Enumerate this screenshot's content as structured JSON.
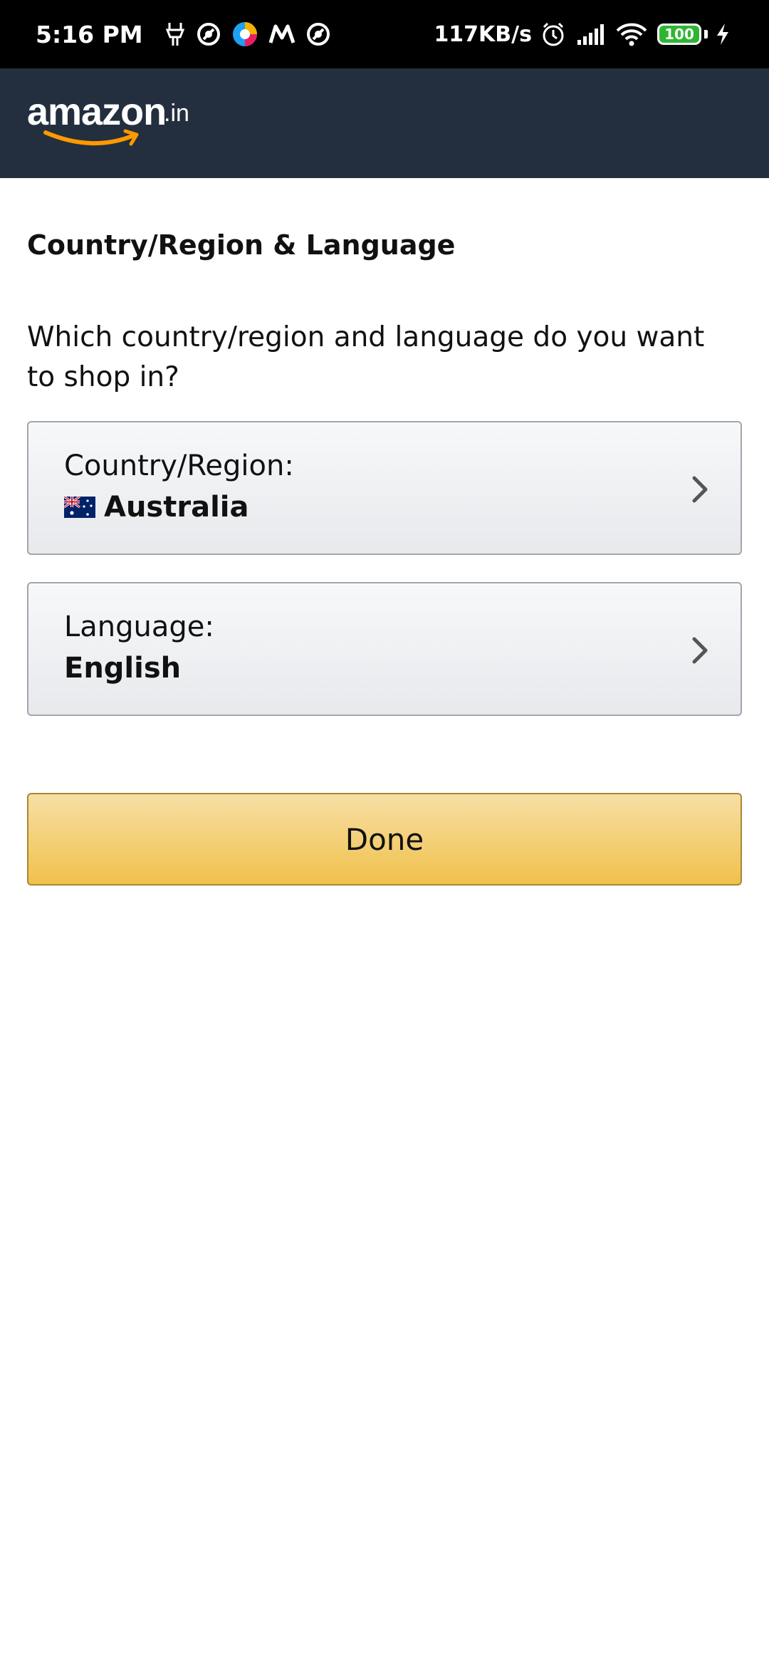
{
  "status_bar": {
    "time": "5:16 PM",
    "left_icons": [
      "tools-icon",
      "notification-icon",
      "browser-icon",
      "m-app-icon",
      "notification-icon"
    ],
    "network_speed": "117KB/s",
    "right_icons": [
      "alarm-icon",
      "signal-icon",
      "wifi-icon",
      "battery-icon",
      "charging-icon"
    ],
    "battery_level": "100",
    "battery_color": "#2fb535"
  },
  "header": {
    "logo_text": "amazon",
    "logo_suffix": ".in",
    "background": "#232f3e",
    "smile_color": "#ff9900"
  },
  "content": {
    "title": "Country/Region & Language",
    "question": "Which country/region and language do you want to shop in?",
    "country": {
      "label": "Country/Region:",
      "value": "Australia",
      "flag_icon": "australia-flag-icon"
    },
    "language": {
      "label": "Language:",
      "value": "English"
    },
    "done_label": "Done",
    "done_color": "#f0c14b"
  }
}
